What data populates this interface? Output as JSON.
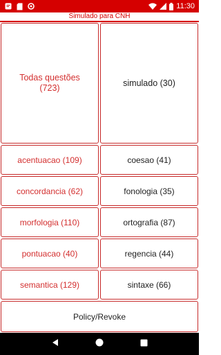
{
  "status_bar": {
    "time": "11:30",
    "left_icons": [
      "notification-icon",
      "sd-card-icon",
      "sync-icon"
    ],
    "right_icons": [
      "wifi-icon",
      "signal-icon",
      "battery-icon"
    ]
  },
  "title": "Simulado para CNH",
  "buttons": {
    "todas_line1": "Todas questões",
    "todas_line2": "(723)",
    "simulado": "simulado (30)",
    "acentuacao": "acentuacao (109)",
    "coesao": "coesao (41)",
    "concordancia": "concordancia (62)",
    "fonologia": "fonologia (35)",
    "morfologia": "morfologia (110)",
    "ortografia": "ortografia (87)",
    "pontuacao": "pontuacao (40)",
    "regencia": "regencia (44)",
    "semantica": "semantica (129)",
    "sintaxe": "sintaxe (66)",
    "policy": "Policy/Revoke"
  },
  "nav_icons": [
    "back-icon",
    "home-icon",
    "recents-icon"
  ],
  "colors": {
    "accent": "#d50000",
    "border": "#c62828",
    "red_text": "#d32f2f",
    "text": "#222222",
    "navbar": "#000000"
  }
}
